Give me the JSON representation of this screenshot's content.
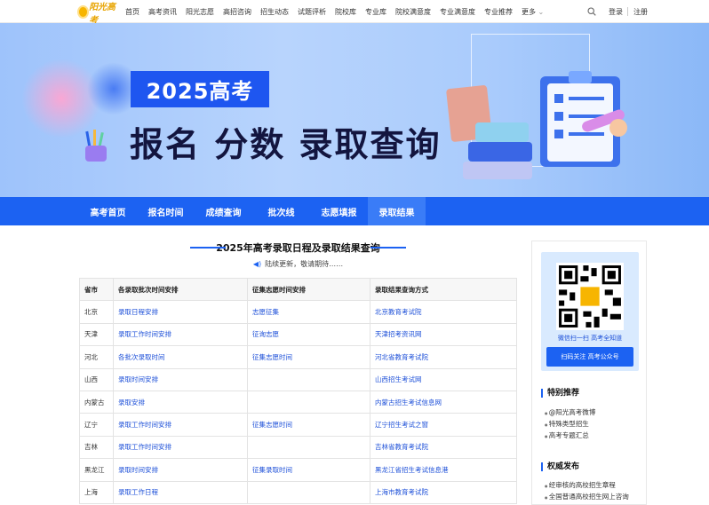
{
  "topnav": {
    "logo": "阳光高考",
    "links": [
      "首页",
      "高考资讯",
      "阳光志愿",
      "高招咨询",
      "招生动态",
      "试题评析",
      "院校库",
      "专业库",
      "院校满意度",
      "专业满意度",
      "专业推荐",
      "更多"
    ],
    "login": "登录",
    "register": "注册"
  },
  "banner": {
    "tag": "2025高考",
    "title": "报名 分数 录取查询"
  },
  "subnav": {
    "items": [
      "高考首页",
      "报名时间",
      "成绩查询",
      "批次线",
      "志愿填报",
      "录取结果"
    ],
    "active_index": 5
  },
  "main": {
    "title": "2025年高考录取日程及录取结果查询",
    "notice": "陆续更新，敬请期待……",
    "table": {
      "headers": [
        "省市",
        "各录取批次时间安排",
        "征集志愿时间安排",
        "录取结果查询方式"
      ],
      "rows": [
        [
          "北京",
          "录取日程安排",
          "志愿征集",
          "北京教育考试院"
        ],
        [
          "天津",
          "录取工作时间安排",
          "征询志愿",
          "天津招考资讯网"
        ],
        [
          "河北",
          "各批次录取时间",
          "征集志愿时间",
          "河北省教育考试院"
        ],
        [
          "山西",
          "录取时间安排",
          "",
          "山西招生考试网"
        ],
        [
          "内蒙古",
          "录取安排",
          "",
          "内蒙古招生考试信息网"
        ],
        [
          "辽宁",
          "录取工作时间安排",
          "征集志愿时间",
          "辽宁招生考试之窗"
        ],
        [
          "吉林",
          "录取工作时间安排",
          "",
          "吉林省教育考试院"
        ],
        [
          "黑龙江",
          "录取时间安排",
          "征集录取时间",
          "黑龙江省招生考试信息港"
        ],
        [
          "上海",
          "录取工作日程",
          "",
          "上海市教育考试院"
        ]
      ]
    }
  },
  "sidebar": {
    "qr_caption": "微信扫一扫  高考全知道",
    "qr_button": "扫码关注 高考公众号",
    "special_title": "特别推荐",
    "special_items": [
      "@阳光高考微博",
      "特殊类型招生",
      "高考专题汇总"
    ],
    "auth_title": "权威发布",
    "auth_items": [
      "经审核的高校招生章程",
      "全国普通高校招生网上咨询"
    ]
  }
}
